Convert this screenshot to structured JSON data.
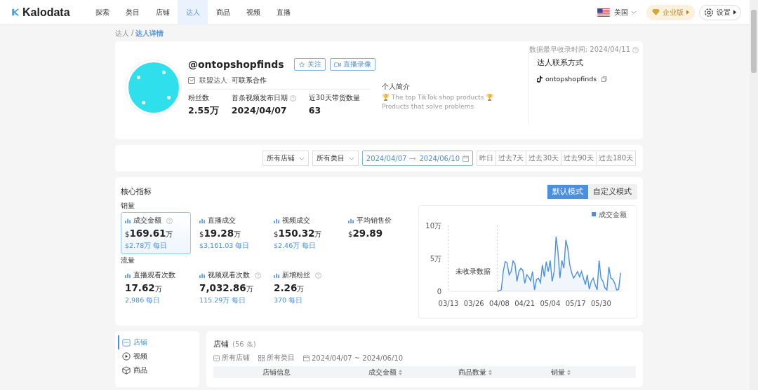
{
  "nav": {
    "brand": "Kalodata",
    "tabs": [
      {
        "label": "探索",
        "selected": false
      },
      {
        "label": "类目",
        "selected": false
      },
      {
        "label": "店铺",
        "selected": false
      },
      {
        "label": "达人",
        "selected": true
      },
      {
        "label": "商品",
        "selected": false
      },
      {
        "label": "视频",
        "selected": false
      },
      {
        "label": "直播",
        "selected": false
      }
    ],
    "region": "美国",
    "plan": "企业版",
    "settings": "设置"
  },
  "breadcrumb": {
    "parent": "达人",
    "separator": "/",
    "current": "达人详情"
  },
  "profile": {
    "collected_since": "数据最早收录时间: 2024/04/11",
    "handle": "@ontopshopfinds",
    "follow": "关注",
    "live_recording": "直播录像",
    "tags": [
      "联盟达人",
      "可联系合作"
    ],
    "stats": [
      {
        "label": "粉丝数",
        "value": "2.55万",
        "help": false
      },
      {
        "label": "首条视频发布日期",
        "value": "2024/04/07",
        "help": true
      },
      {
        "label": "近30天带货数量",
        "value": "63",
        "help": false
      }
    ],
    "bio_title": "个人简介",
    "bio_lines": [
      "🏆 The top TikTok shop products 🏆",
      "Products that solve problems"
    ],
    "contact_title": "达人联系方式",
    "contact_handle": "ontopshopfinds"
  },
  "filters": {
    "shop": "所有店铺",
    "category": "所有类目",
    "date_from": "2024/04/07",
    "date_to": "2024/06/10",
    "ranges": [
      {
        "label": "昨日",
        "selected": false
      },
      {
        "label": "过去7天",
        "selected": false
      },
      {
        "label": "过去30天",
        "selected": false
      },
      {
        "label": "过去90天",
        "selected": false
      },
      {
        "label": "过去180天",
        "selected": false
      }
    ]
  },
  "core": {
    "title": "核心指标",
    "modes": [
      {
        "label": "默认模式",
        "selected": true
      },
      {
        "label": "自定义模式",
        "selected": false
      }
    ],
    "groups": [
      {
        "title": "销量",
        "metrics": [
          {
            "label": "成交金额",
            "prefix": "$",
            "value": "169.61",
            "unit": "万",
            "daily": "$2.78万 每日",
            "help": true,
            "selected": true
          },
          {
            "label": "直播成交",
            "prefix": "$",
            "value": "19.28",
            "unit": "万",
            "daily": "$3,161.03 每日",
            "help": false,
            "selected": false
          },
          {
            "label": "视频成交",
            "prefix": "$",
            "value": "150.32",
            "unit": "万",
            "daily": "$2.46万 每日",
            "help": false,
            "selected": false
          },
          {
            "label": "平均销售价",
            "prefix": "$",
            "value": "29.89",
            "help": false,
            "selected": false
          }
        ]
      },
      {
        "title": "流量",
        "metrics": [
          {
            "label": "直播观看次数",
            "value": "17.62",
            "unit": "万",
            "daily": "2,986 每日",
            "help": false,
            "selected": false
          },
          {
            "label": "视频观看次数",
            "value": "7,032.86",
            "unit": "万",
            "daily": "115.29万 每日",
            "help": true,
            "selected": false
          },
          {
            "label": "新增粉丝",
            "value": "2.26",
            "unit": "万",
            "daily": "370 每日",
            "help": true,
            "selected": false
          }
        ]
      }
    ],
    "chart_data": {
      "type": "area",
      "ylim": [
        0,
        10
      ],
      "categories": [
        "03/13",
        null,
        null,
        null,
        null,
        null,
        null,
        null,
        null,
        null,
        null,
        null,
        null,
        "03/26",
        null,
        null,
        null,
        null,
        null,
        null,
        null,
        null,
        null,
        null,
        null,
        null,
        "04/08",
        null,
        null,
        null,
        null,
        null,
        null,
        null,
        null,
        null,
        null,
        null,
        null,
        "04/21",
        null,
        null,
        null,
        null,
        null,
        null,
        null,
        null,
        null,
        null,
        null,
        null,
        "05/04",
        null,
        null,
        null,
        null,
        null,
        null,
        null,
        null,
        null,
        null,
        null,
        null,
        "05/17",
        null,
        null,
        null,
        null,
        null,
        null,
        null,
        null,
        null,
        null,
        null,
        null,
        "05/30",
        null,
        null,
        null,
        null,
        null,
        null,
        null,
        null,
        null,
        null
      ],
      "yticks": [
        {
          "value": 0,
          "label": "0"
        },
        {
          "value": 5,
          "label": "5万"
        },
        {
          "value": 10,
          "label": "10万"
        }
      ],
      "annotations": [
        {
          "text": "未收录数据"
        }
      ],
      "series": [
        {
          "name": "成交金额",
          "color": "#4a90e2",
          "values": [
            null,
            null,
            null,
            null,
            null,
            null,
            null,
            null,
            null,
            null,
            null,
            null,
            null,
            null,
            null,
            null,
            null,
            null,
            null,
            null,
            null,
            null,
            null,
            null,
            null,
            0,
            0.1,
            0.2,
            3,
            4.5,
            4.3,
            2.5,
            3,
            4.6,
            4.2,
            1.5,
            3,
            3.5,
            3.2,
            1.2,
            2.5,
            2.2,
            1.6,
            3,
            0.2,
            1.8,
            2,
            1.3,
            4,
            2.2,
            4.5,
            3,
            4.7,
            1.5,
            3,
            8.3,
            6,
            2,
            4.7,
            3.5,
            7.8,
            6.5,
            4,
            2.8,
            2,
            2.5,
            3,
            2.2,
            3,
            2,
            1,
            2.5,
            0.3,
            1.5,
            2,
            1,
            0.2,
            4.7,
            2,
            1.5,
            0.5,
            0.2,
            3.7,
            2,
            1.8,
            1.2,
            0.2,
            0.3,
            2.8
          ]
        }
      ]
    }
  },
  "sections": [
    {
      "label": "店铺",
      "selected": true
    },
    {
      "label": "视频",
      "selected": false
    },
    {
      "label": "商品",
      "selected": false
    }
  ],
  "shops": {
    "title": "店铺",
    "count": "(56 条)",
    "filter_shop": "所有店铺",
    "filter_category": "所有类目",
    "filter_date": "2024/04/07 ~ 2024/06/10",
    "columns": [
      {
        "label": "店铺信息",
        "sortable": false
      },
      {
        "label": "成交金额",
        "sortable": true
      },
      {
        "label": "商品数量",
        "sortable": true
      },
      {
        "label": "销量",
        "sortable": true
      }
    ]
  }
}
